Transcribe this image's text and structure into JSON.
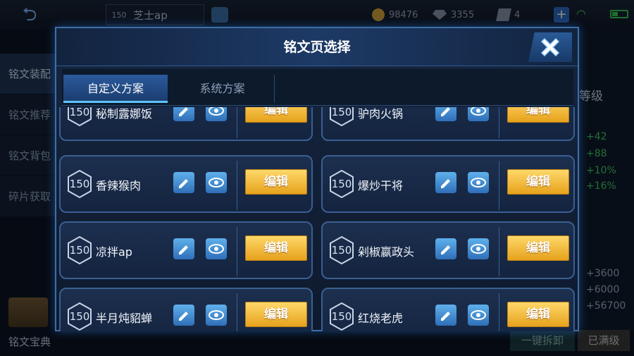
{
  "topbar": {
    "player_level": "150",
    "player_name": "芝士ap",
    "gold": "98476",
    "diamonds": "3355",
    "tickets": "4"
  },
  "left_menu": {
    "items": [
      "铭文装配",
      "铭文推荐",
      "铭文背包",
      "碎片获取"
    ],
    "bottom_label": "铭文宝典"
  },
  "right_panel": {
    "title": "等级",
    "stats_green": [
      "+42",
      "+88",
      "+10%",
      "+16%"
    ],
    "stats_gray": [
      "+3600",
      "+6000",
      "+56700"
    ],
    "dismantle_label": "一键拆卸",
    "maxed_label": "已满级"
  },
  "modal": {
    "title": "铭文页选择",
    "tabs": [
      "自定义方案",
      "系统方案"
    ],
    "edit_label": "编辑",
    "pages": [
      {
        "level": "150",
        "name": "秘制露娜饭"
      },
      {
        "level": "150",
        "name": "驴肉火锅"
      },
      {
        "level": "150",
        "name": "香辣猴肉"
      },
      {
        "level": "150",
        "name": "爆炒干将"
      },
      {
        "level": "150",
        "name": "凉拌ap"
      },
      {
        "level": "150",
        "name": "剁椒嬴政头"
      },
      {
        "level": "150",
        "name": "半月炖貂蝉"
      },
      {
        "level": "150",
        "name": "红烧老虎"
      }
    ]
  },
  "colors": {
    "accent_blue": "#3f6ea8",
    "edit_button_gold": "#e6a21c",
    "stat_green": "#40c96a"
  }
}
